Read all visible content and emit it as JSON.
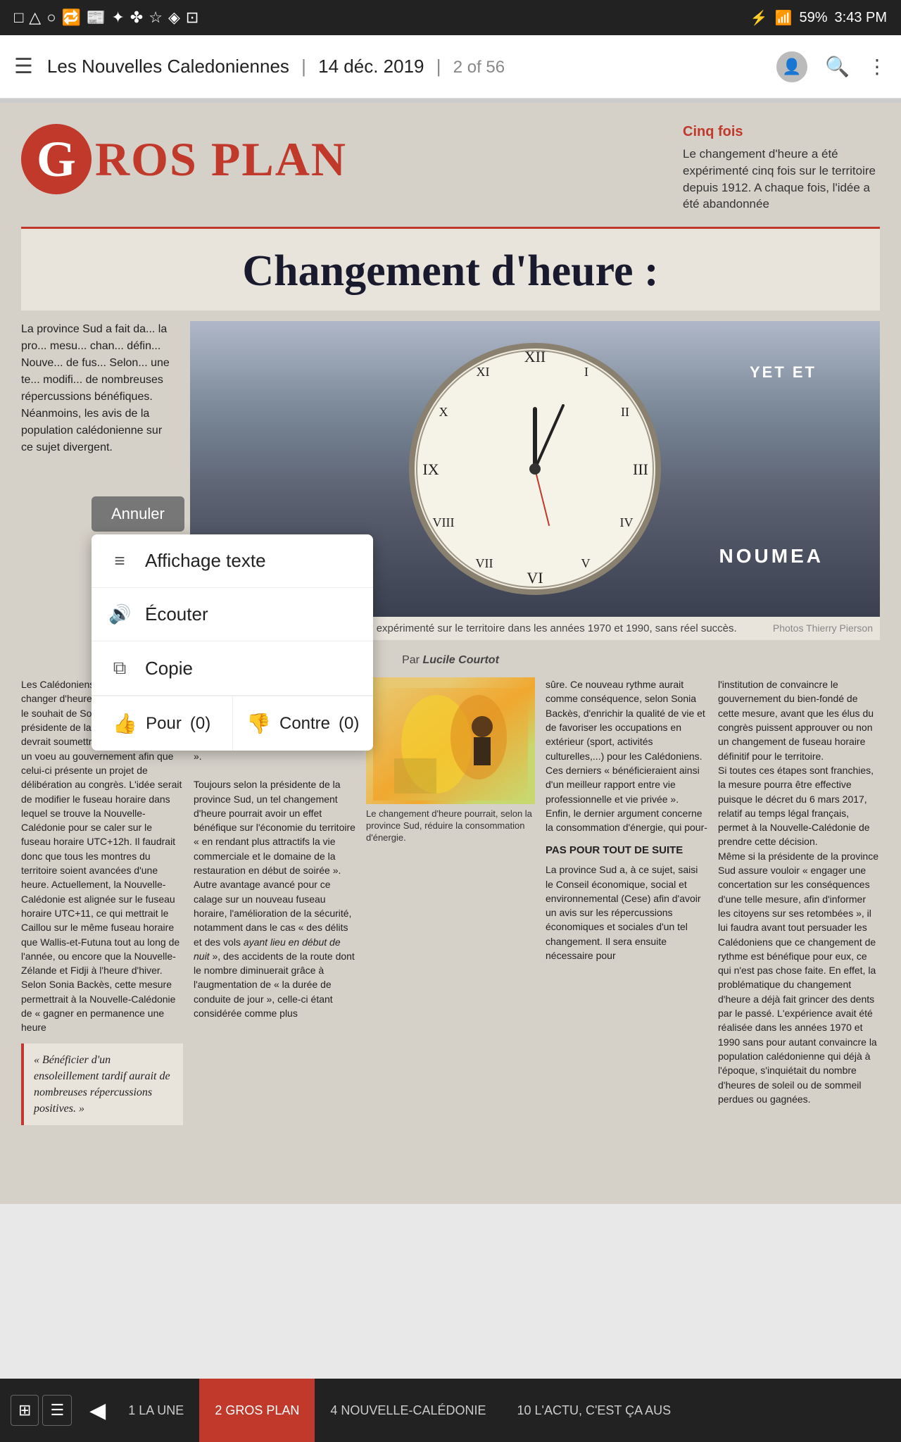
{
  "statusBar": {
    "leftIcons": [
      "□",
      "△",
      "○",
      "☰",
      "📰",
      "❖",
      "❋"
    ],
    "battery": "59%",
    "time": "3:43 PM",
    "bluetooth": "⚡",
    "signal": "📶"
  },
  "topNav": {
    "menuIcon": "☰",
    "title": "Les Nouvelles Caledoniennes",
    "date": "14 déc. 2019",
    "pageInfo": "2 of 56",
    "searchIcon": "🔍",
    "moreIcon": "⋮"
  },
  "article": {
    "logoG": "G",
    "logoText": "ROS PLAN",
    "cinqFoisTitle": "Cinq fois",
    "cinqFoisText": "Le changement d'heure a été expérimenté cinq fois sur le territoire depuis 1912. A chaque fois, l'idée a été abandonnée",
    "headline": "Changement d'heure :",
    "imageCaption": "Le changement d'heure avait déjà été expérimenté sur le territoire dans les années 1970 et 1990, sans réel succès.",
    "imageCaptionRight": "Photos Thierry Pierson",
    "noumea": "NOUMEA",
    "introText": "La province Sud a fait da... la pro... mesu... chan... défin... Nouve... de fus... Selon... une te... modifi... de nombreuses répercussions bénéfices. Néanmoins, les avis de la population calédonienne sur ce sujet divergent.",
    "byline": "Par Lucile Courtot",
    "col1": "Les Calédoniens devront-ils bientôt changer d'heure ? C'est en tout cas le souhait de Sonia Backès, présidente de la province Sud, qui devrait soumettre le 19 décembre, un voeu au gouvernement afin que celui-ci présente un projet de délibération au congrès.\nL'idée serait de modifier le fuseau horaire dans lequel se trouve la Nouvelle-Calédonie pour se caler sur le fuseau horaire UTC+12h.\nIl faudrait donc que tous les montres du territoire soient avancées d'une heure. Actuellement, la Nouvelle-Calédonie est alignée sur le fuseau horaire UTC+11, ce qui mettrait le Caillou sur le même fuseau horaire que Wallis-et-Futuna tout au long de l'année, ou encore que la Nouvelle-Zélande et Fidji à l'heure d'hiver.\nSelon Sonia Backès, cette mesure permettrait à la Nouvelle-Calédonie de « gagner en permanence une heure",
    "col1PullQuote": "« Bénéficier d'un ensoleillement tardif aurait de nombreuses répercussions positives. »",
    "col2": "supplémentaire d'ensoleillement en fin de journée. Bénéficier d'un ensoleillement tardif, tout au long de l'année, aurait en effet de nombreuses répercussions positives ».\n\nToujours selon la présidente de la province Sud, un tel changement d'heure pourrait avoir un effet bénéfique sur l'économie du territoire « en rendant plus attractifs la vie commerciale et le domaine de la restauration en début de soirée ».\nAutre avantage avancé pour ce calage sur un nouveau fuseau horaire, l'amélioration de la sécurité, notamment dans le cas « des délits et des vols ayant lieu en début de nuit », des accidents de la route dont le nombre diminuerait grâce à l'augmentation de « la durée de conduite de jour », celle-ci étant considérée comme plus",
    "centerImageCaption": "Le changement d'heure pourrait, selon la province Sud, réduire la consommation d'énergie.",
    "col3": "sûre. Ce nouveau rythme aurait comme conséquence, selon Sonia Backès, d'enrichir la qualité de vie et de favoriser les occupations en extérieur (sport, activités culturelles,...) pour les Calédoniens. Ces derniers « bénéficieraient ainsi d'un meilleur rapport entre vie professionnelle et vie privée ».\nEnfin, le dernier argument concerne la consommation d'énergie, qui pour-",
    "col3SectionHeader": "PAS POUR TOUT DE SUITE",
    "col3Continue": "La province Sud a, à ce sujet, saisi le Conseil économique, social et environnemental (Cese) afin d'avoir un avis sur les répercussions économiques et sociales d'un tel changement. Il sera ensuite nécessaire pour",
    "col4": "l'institution de convaincre le gouvernement du bien-fondé de cette mesure, avant que les élus du congrès puissent approuver ou non un changement de fuseau horaire définitif pour le territoire.\nSi toutes ces étapes sont franchies, la mesure pourra être effective puisque le décret du 6 mars 2017, relatif au temps légal français, permet à la Nouvelle-Calédonie de prendre cette décision.\nMême si la présidente de la province Sud assure vouloir « engager une concertation sur les conséquences d'une telle mesure, afin d'informer les citoyens sur ses retombées », il lui faudra avant tout persuader les Calédoniens que ce changement de rythme est bénéfique pour eux, ce qui n'est pas chose faite. En effet, la problématique du changement d'heure a déjà fait grincer des dents par le passé. L'expérience avait été réalisée dans les années 1970 et 1990 sans pour autant convaincre la population calédonienne qui déjà à l'époque, s'inquiétait du nombre d'heures de soleil ou de sommeil perdues ou gagnées."
  },
  "contextMenu": {
    "cancelLabel": "Annuler",
    "items": [
      {
        "icon": "list",
        "label": "Affichage texte"
      },
      {
        "icon": "volume",
        "label": "Écouter"
      },
      {
        "icon": "copy",
        "label": "Copie"
      }
    ],
    "pourLabel": "Pour",
    "pourCount": "(0)",
    "contreLabel": "Contre",
    "contreCount": "(0)"
  },
  "bottomNav": {
    "pages": [
      {
        "num": "1",
        "label": "LA UNE",
        "active": false
      },
      {
        "num": "2",
        "label": "GROS PLAN",
        "active": true
      },
      {
        "num": "4",
        "label": "NOUVELLE-CALÉDONIE",
        "active": false
      },
      {
        "num": "10",
        "label": "L'ACTU, C'EST ÇA AUS",
        "active": false
      }
    ],
    "prevArrow": "◀",
    "nextArrow": "...",
    "gridIcon": "⊞",
    "listIcon": "☰"
  }
}
